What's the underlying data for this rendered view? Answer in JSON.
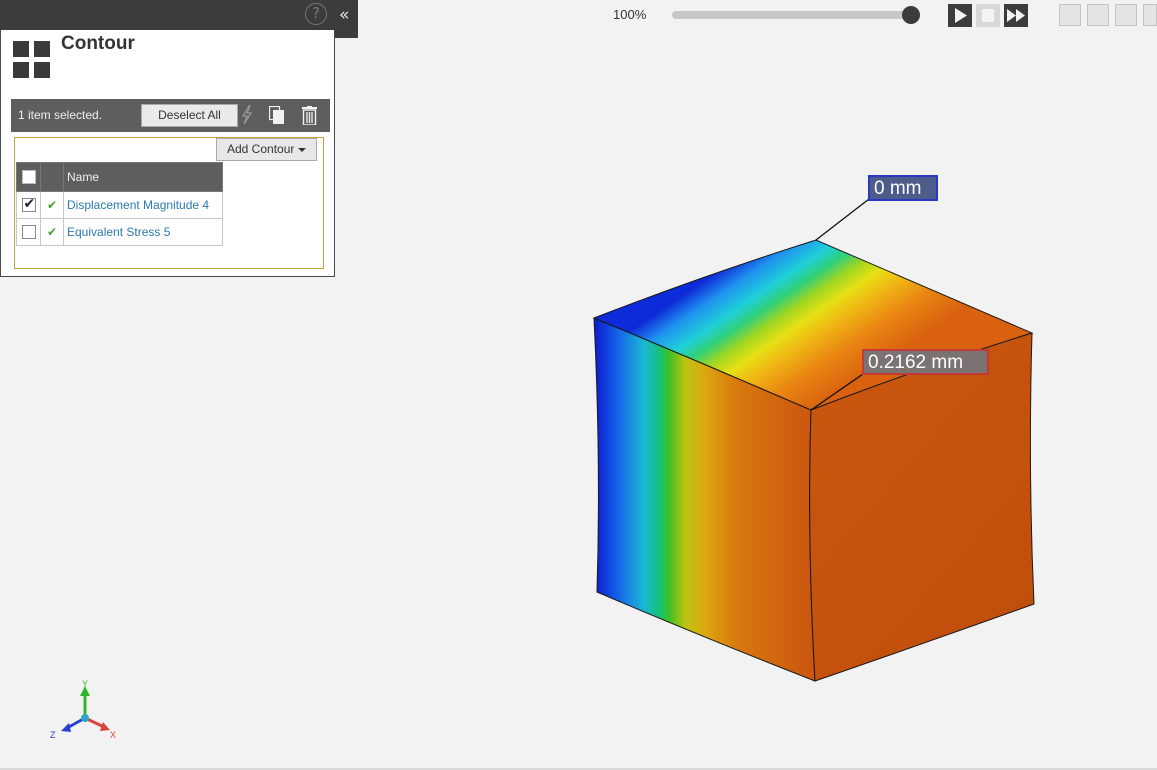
{
  "panel": {
    "title": "Contour",
    "help_glyph": "?",
    "collapse_glyph": "«",
    "selection_text": "1 item selected.",
    "deselect_label": "Deselect All",
    "add_contour_label": "Add Contour",
    "table": {
      "header_name": "Name",
      "rows": [
        {
          "name": "Displacement Magnitude 4",
          "checked": true,
          "status": "ok"
        },
        {
          "name": "Equivalent Stress 5",
          "checked": false,
          "status": "ok"
        }
      ]
    }
  },
  "playback": {
    "zoom_label": "100%",
    "slider_value_fraction": 1.0
  },
  "viewport": {
    "min_label": "0 mm",
    "max_label": "0.2162 mm",
    "triad": {
      "x": "X",
      "y": "Y",
      "z": "Z"
    }
  },
  "colors": {
    "contour_low": "#1a2fd6",
    "contour_high": "#c9520e",
    "ok_green": "#4aa02c",
    "link_blue": "#2a7ab0"
  }
}
